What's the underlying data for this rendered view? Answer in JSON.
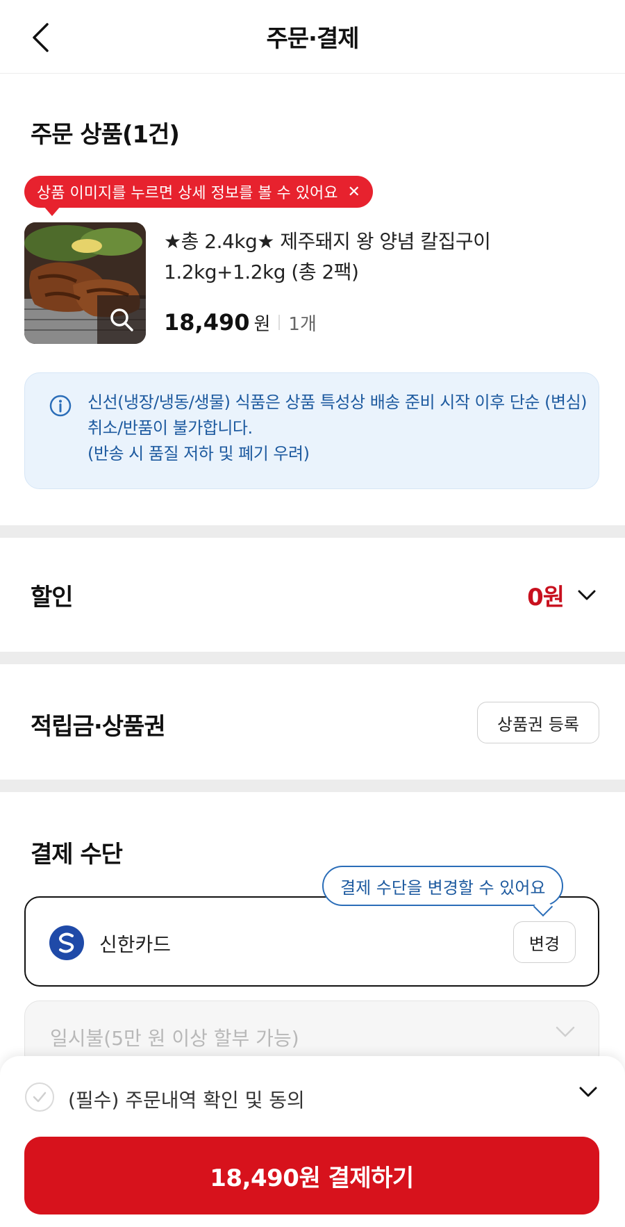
{
  "header": {
    "title": "주문·결제",
    "back_icon": "chevron-left-icon"
  },
  "order_items": {
    "title": "주문 상품(1건)",
    "tooltip": "상품 이미지를 누르면 상세 정보를 볼 수 있어요",
    "product": {
      "name": "★총 2.4kg★ 제주돼지 왕 양념 칼집구이 1.2kg+1.2kg (총 2팩)",
      "price": "18,490",
      "price_unit": "원",
      "quantity": "1개"
    },
    "notice_lines": [
      "신선(냉장/냉동/생물) 식품은 상품 특성상 배송 준비 시작 이후 단순 (변심) 취소/반품이 불가합니다.",
      "(반송 시 품질 저하 및 폐기 우려)"
    ]
  },
  "discount": {
    "label": "할인",
    "amount": "0원"
  },
  "points": {
    "label": "적립금·상품권",
    "register_button": "상품권 등록"
  },
  "payment": {
    "title": "결제 수단",
    "tooltip": "결제 수단을 변경할 수 있어요",
    "card_name": "신한카드",
    "change_button": "변경",
    "installment_placeholder": "일시불(5만 원 이상 할부 가능)"
  },
  "bottom": {
    "agree_text": "(필수) 주문내역 확인 및 동의",
    "pay_button": "18,490원 결제하기"
  },
  "colors": {
    "accent_red": "#d7121c",
    "notice_bg": "#eaf3fc",
    "notice_text": "#1d5a9f",
    "discount_red": "#c8101e"
  }
}
